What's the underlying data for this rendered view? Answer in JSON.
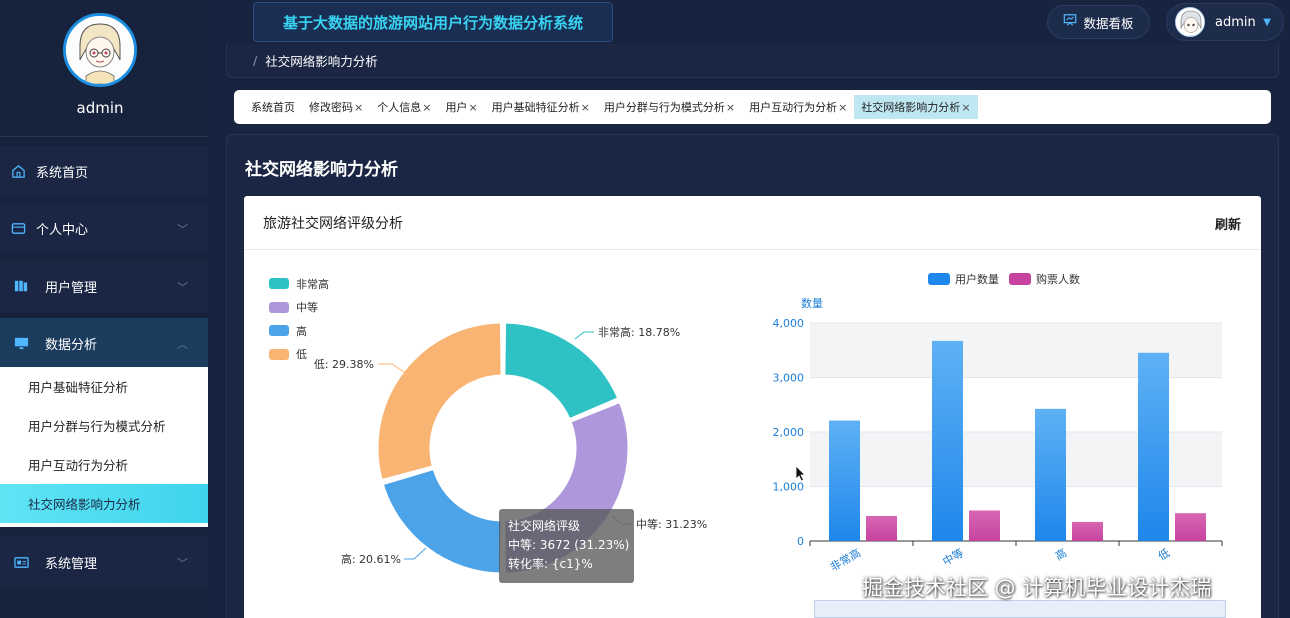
{
  "header": {
    "app_title": "基于大数据的旅游网站用户行为数据分析系统",
    "dashboard_label": "数据看板",
    "user_name": "admin"
  },
  "sidebar": {
    "profile_name": "admin",
    "items": [
      {
        "label": "系统首页",
        "icon": "home-icon"
      },
      {
        "label": "个人中心",
        "icon": "wallet-icon"
      },
      {
        "label": "用户管理",
        "icon": "books-icon"
      },
      {
        "label": "数据分析",
        "icon": "monitor-icon"
      },
      {
        "label": "系统管理",
        "icon": "id-card-icon"
      }
    ],
    "submenu": [
      {
        "label": "用户基础特征分析"
      },
      {
        "label": "用户分群与行为模式分析"
      },
      {
        "label": "用户互动行为分析"
      },
      {
        "label": "社交网络影响力分析"
      }
    ]
  },
  "breadcrumb": {
    "current": "社交网络影响力分析"
  },
  "tabs": [
    {
      "label": "系统首页",
      "closable": false
    },
    {
      "label": "修改密码",
      "closable": true
    },
    {
      "label": "个人信息",
      "closable": true
    },
    {
      "label": "用户",
      "closable": true
    },
    {
      "label": "用户基础特征分析",
      "closable": true
    },
    {
      "label": "用户分群与行为模式分析",
      "closable": true
    },
    {
      "label": "用户互动行为分析",
      "closable": true
    },
    {
      "label": "社交网络影响力分析",
      "closable": true
    }
  ],
  "tab_close": "×",
  "page": {
    "title": "社交网络影响力分析"
  },
  "card": {
    "title": "旅游社交网络评级分析",
    "refresh_label": "刷新"
  },
  "colors": {
    "very_high": "#2ec2c4",
    "medium": "#ae97db",
    "high": "#4ca3e8",
    "low": "#f9b474",
    "bar_users": "#1e87eb",
    "bar_buyers": "#c6439f"
  },
  "chart_data": [
    {
      "type": "pie",
      "variant": "donut",
      "legend": [
        "非常高",
        "中等",
        "高",
        "低"
      ],
      "slices": [
        {
          "name": "非常高",
          "percent": 18.78,
          "label": "非常高: 18.78%"
        },
        {
          "name": "中等",
          "percent": 31.23,
          "label": "中等: 31.23%"
        },
        {
          "name": "高",
          "percent": 20.61,
          "label": "高: 20.61%"
        },
        {
          "name": "低",
          "percent": 29.38,
          "label": "低: 29.38%"
        }
      ],
      "tooltip": {
        "title": "社交网络评级",
        "line1": "中等: 3672 (31.23%)",
        "line2": "转化率: {c1}%"
      },
      "legend_position": "top-left"
    },
    {
      "type": "bar",
      "categories": [
        "非常高",
        "中等",
        "高",
        "低"
      ],
      "series": [
        {
          "name": "用户数量",
          "values": [
            2210,
            3672,
            2425,
            3454
          ]
        },
        {
          "name": "购票人数",
          "values": [
            460,
            560,
            350,
            510
          ]
        }
      ],
      "ylabel": "数量",
      "ylim": [
        0,
        4000
      ],
      "yticks": [
        "0",
        "1,000",
        "2,000",
        "3,000",
        "4,000"
      ],
      "legend_position": "top-center",
      "grid": true
    }
  ],
  "watermark": "掘金技术社区 @ 计算机毕业设计杰瑞"
}
